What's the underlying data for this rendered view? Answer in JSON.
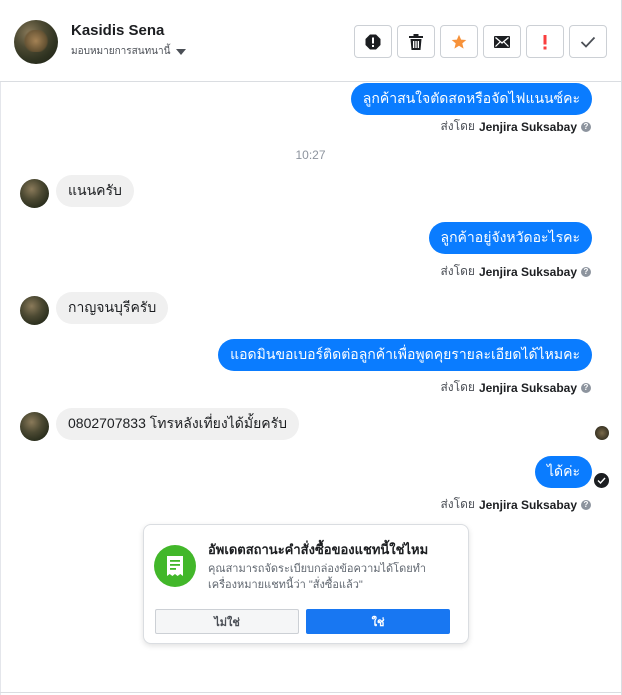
{
  "header": {
    "customer_name": "Kasidis Sena",
    "assign_label": "มอบหมายการสนทนานี้"
  },
  "toolbar": {
    "buttons": [
      {
        "name": "spam",
        "icon": "alert-octagon-icon"
      },
      {
        "name": "delete",
        "icon": "trash-icon"
      },
      {
        "name": "star",
        "icon": "star-icon",
        "color": "#f7923a"
      },
      {
        "name": "unread",
        "icon": "envelope-icon"
      },
      {
        "name": "follow-up",
        "icon": "exclamation-icon",
        "color": "#fa3e3e"
      },
      {
        "name": "done",
        "icon": "check-icon"
      }
    ]
  },
  "messages": [
    {
      "dir": "out",
      "text": "ลูกค้าสนใจตัดสดหรือจัดไฟแนนซ์คะ",
      "sent_by_prefix": "ส่งโดย",
      "sent_by": "Jenjira Suksabay"
    },
    {
      "dir": "time",
      "text": "10:27"
    },
    {
      "dir": "in",
      "text": "แนนครับ"
    },
    {
      "dir": "out",
      "text": "ลูกค้าอยู่จังหวัดอะไรคะ",
      "sent_by_prefix": "ส่งโดย",
      "sent_by": "Jenjira Suksabay"
    },
    {
      "dir": "in",
      "text": "กาญจนบุรีครับ"
    },
    {
      "dir": "out",
      "text": "แอดมินขอเบอร์ติดต่อลูกค้าเพื่อพูดคุยรายละเอียดได้ไหมคะ",
      "sent_by_prefix": "ส่งโดย",
      "sent_by": "Jenjira Suksabay"
    },
    {
      "dir": "in",
      "text": "0802707833 โทรหลังเที่ยงได้มั้ยครับ"
    },
    {
      "dir": "out",
      "text": "ได้ค่ะ",
      "sent_by_prefix": "ส่งโดย",
      "sent_by": "Jenjira Suksabay"
    }
  ],
  "order_card": {
    "title": "อัพเดตสถานะคำสั่งซื้อของแชทนี้ใช่ไหม",
    "description": "คุณสามารถจัดระเบียบกล่องข้อความได้โดยทำเครื่องหมายแชทนี้ว่า \"สั่งซื้อแล้ว\"",
    "no_label": "ไม่ใช่",
    "yes_label": "ใช่",
    "icon": "receipt-icon",
    "accent": "#42b72a"
  },
  "colors": {
    "outgoing_bubble": "#0a7cff",
    "incoming_bubble": "#f0f0f0",
    "primary_button": "#1877f2"
  }
}
